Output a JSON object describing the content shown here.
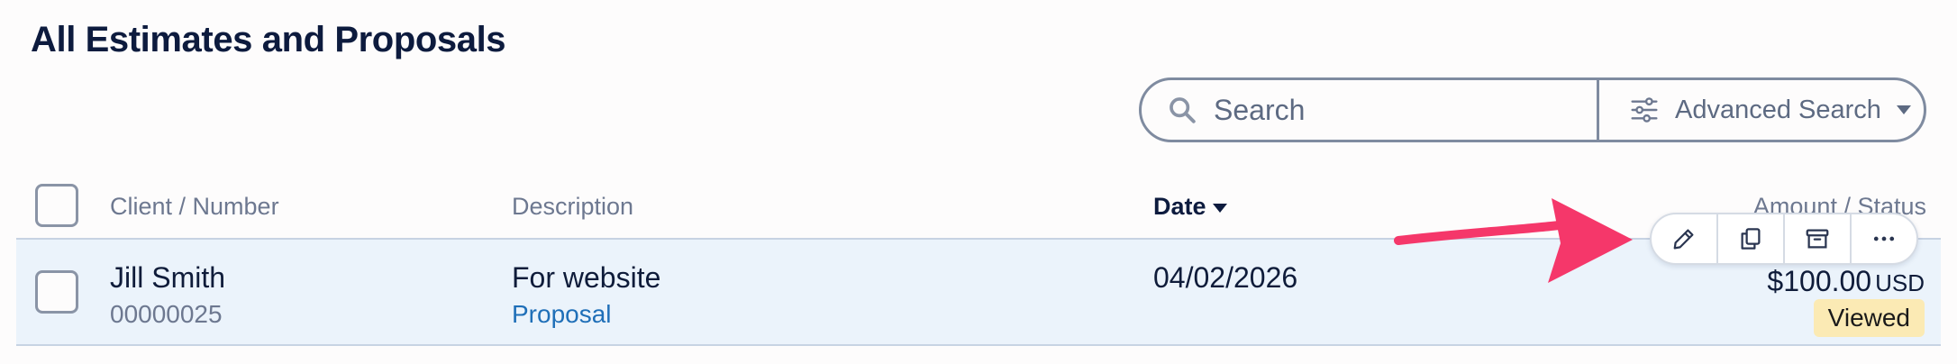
{
  "page": {
    "title": "All Estimates and Proposals"
  },
  "search": {
    "placeholder": "Search",
    "advanced_label": "Advanced Search",
    "icons": {
      "search": "search-icon",
      "advanced": "sliders-icon",
      "caret": "caret-down-icon"
    }
  },
  "table": {
    "headers": {
      "client": "Client / Number",
      "description": "Description",
      "date": "Date",
      "amount": "Amount / Status"
    },
    "sort": {
      "column": "date",
      "direction": "descending"
    },
    "rows": [
      {
        "client_name": "Jill Smith",
        "client_number": "00000025",
        "description": "For website",
        "type": "Proposal",
        "date": "04/02/2026",
        "amount": "$100.00",
        "currency": "USD",
        "status": "Viewed"
      }
    ]
  },
  "row_actions": [
    {
      "name": "edit",
      "icon": "pencil-icon"
    },
    {
      "name": "duplicate",
      "icon": "duplicate-icon"
    },
    {
      "name": "archive",
      "icon": "archive-icon"
    },
    {
      "name": "more",
      "icon": "more-icon"
    }
  ],
  "colors": {
    "title": "#0d1b3e",
    "row_highlight": "#ebf3fb",
    "link": "#1f6fb8",
    "status_viewed_bg": "#fbeab4",
    "annotation_arrow": "#f5376a"
  }
}
